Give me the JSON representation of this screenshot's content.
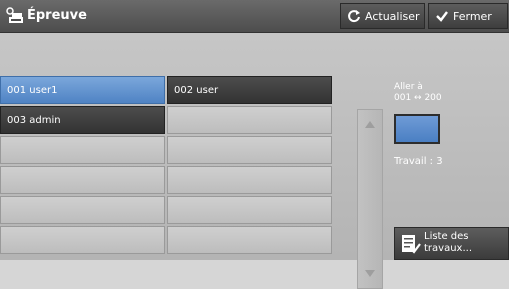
{
  "header": {
    "title": "Épreuve",
    "refresh_label": "Actualiser",
    "close_label": "Fermer"
  },
  "users": [
    {
      "label": "001  user1",
      "state": "selected"
    },
    {
      "label": "002  user",
      "state": "filled"
    },
    {
      "label": "003  admin",
      "state": "filled"
    },
    {
      "label": "",
      "state": "empty"
    },
    {
      "label": "",
      "state": "empty"
    },
    {
      "label": "",
      "state": "empty"
    },
    {
      "label": "",
      "state": "empty"
    },
    {
      "label": "",
      "state": "empty"
    },
    {
      "label": "",
      "state": "empty"
    },
    {
      "label": "",
      "state": "empty"
    },
    {
      "label": "",
      "state": "empty"
    },
    {
      "label": "",
      "state": "empty"
    }
  ],
  "goto": {
    "label": "Aller à",
    "range": "001 ↔ 200"
  },
  "job": {
    "label": "Travail : 3"
  },
  "job_list_button": {
    "line1": "Liste des",
    "line2": "travaux..."
  },
  "colors": {
    "selected": "#5b8fd0",
    "filled": "#3f3f3f",
    "empty": "#c8c8c8"
  }
}
